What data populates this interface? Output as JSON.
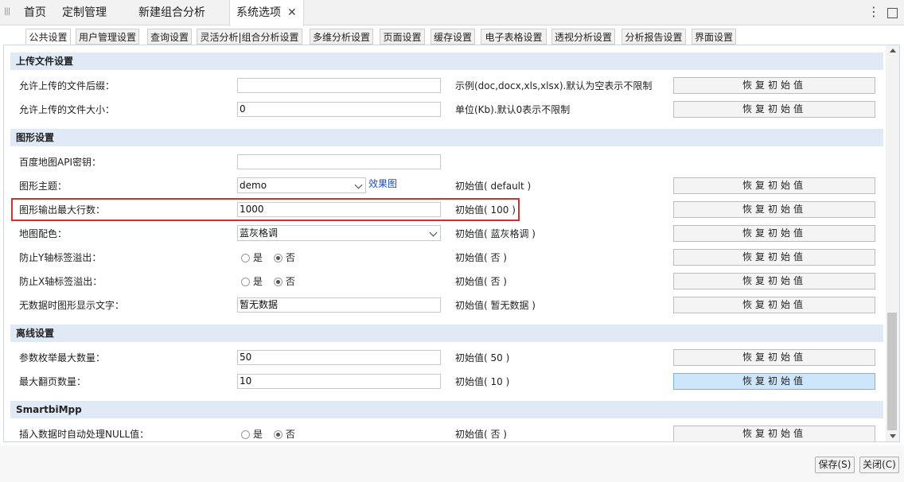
{
  "top_tabs": [
    {
      "label": "首页"
    },
    {
      "label": "定制管理"
    },
    {
      "label": "新建组合分析"
    },
    {
      "label": "系统选项"
    }
  ],
  "sub_tabs": [
    "公共设置",
    "用户管理设置",
    "查询设置",
    "灵活分析|组合分析设置",
    "多维分析设置",
    "页面设置",
    "缓存设置",
    "电子表格设置",
    "透视分析设置",
    "分析报告设置",
    "界面设置"
  ],
  "sections": {
    "upload": "上传文件设置",
    "graph": "图形设置",
    "offline": "离线设置",
    "mpp": "SmartbiMpp"
  },
  "rows": {
    "upload_ext": {
      "label": "允许上传的文件后缀：",
      "value": "",
      "hint": "示例(doc,docx,xls,xlsx).默认为空表示不限制"
    },
    "upload_size": {
      "label": "允许上传的文件大小：",
      "value": "0",
      "hint": "单位(Kb).默认0表示不限制"
    },
    "baidu_key": {
      "label": "百度地图API密钥：",
      "value": ""
    },
    "graph_theme": {
      "label": "图形主题：",
      "value": "demo",
      "link": "效果图",
      "hint": "初始值( default )"
    },
    "graph_max_rows": {
      "label": "图形输出最大行数：",
      "value": "1000",
      "hint": "初始值( 100 )"
    },
    "map_color": {
      "label": "地图配色：",
      "value": "蓝灰格调",
      "hint": "初始值( 蓝灰格调 )"
    },
    "y_overflow": {
      "label": "防止Y轴标签溢出：",
      "yes": "是",
      "no": "否",
      "selected": "否",
      "hint": "初始值( 否 )"
    },
    "x_overflow": {
      "label": "防止X轴标签溢出：",
      "yes": "是",
      "no": "否",
      "selected": "否",
      "hint": "初始值( 否 )"
    },
    "no_data_text": {
      "label": "无数据时图形显示文字：",
      "value": "暂无数据",
      "hint": "初始值( 暂无数据 )"
    },
    "param_max": {
      "label": "参数枚举最大数量：",
      "value": "50",
      "hint": "初始值( 50 )"
    },
    "max_pages": {
      "label": "最大翻页数量：",
      "value": "10",
      "hint": "初始值( 10 )"
    },
    "null_handle": {
      "label": "插入数据时自动处理NULL值：",
      "yes": "是",
      "no": "否",
      "selected": "否",
      "hint": "初始值( 否 )"
    }
  },
  "reset_label": "恢复初始值",
  "buttons": {
    "save": "保存(S)",
    "close": "关闭(C)"
  },
  "colors": {
    "section_bg": "#dfeaf6",
    "highlight_border": "#d43030",
    "link": "#1a4fbf",
    "hover_button": "#cde6fb"
  }
}
